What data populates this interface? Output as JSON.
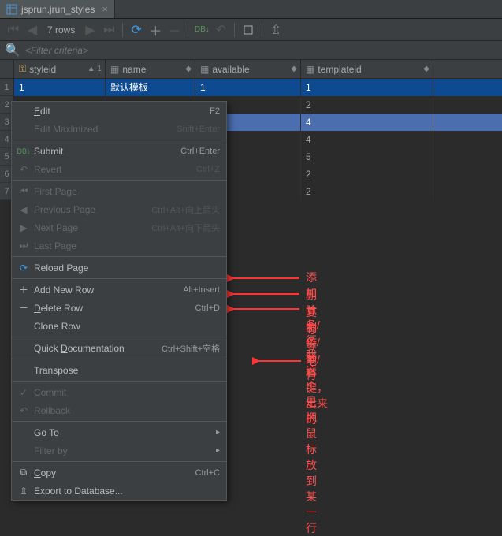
{
  "tab": {
    "title": "jsprun.jrun_styles"
  },
  "toolbar": {
    "rowcount": "7 rows"
  },
  "filter": {
    "placeholder": "<Filter criteria>"
  },
  "columns": [
    {
      "name": "styleid",
      "sort": "▲ 1"
    },
    {
      "name": "name",
      "sort": "◆"
    },
    {
      "name": "available",
      "sort": "◆"
    },
    {
      "name": "templateid",
      "sort": "◆"
    }
  ],
  "rows": [
    {
      "n": "1",
      "cells": [
        "1",
        "默认模板",
        "1",
        "1"
      ],
      "sel": true
    },
    {
      "n": "2",
      "cells": [
        "",
        "",
        "",
        "2"
      ]
    },
    {
      "n": "3",
      "cells": [
        "",
        "",
        "",
        "4"
      ],
      "hov": true
    },
    {
      "n": "4",
      "cells": [
        "",
        "",
        "",
        "4"
      ]
    },
    {
      "n": "5",
      "cells": [
        "",
        "",
        "",
        "5"
      ]
    },
    {
      "n": "6",
      "cells": [
        "",
        "",
        "",
        "2"
      ]
    },
    {
      "n": "7",
      "cells": [
        "",
        "",
        "",
        "2"
      ]
    }
  ],
  "menu": {
    "edit": "Edit",
    "edit_sc": "F2",
    "editmax": "Edit Maximized",
    "editmax_sc": "Shift+Enter",
    "submit": "Submit",
    "submit_sc": "Ctrl+Enter",
    "revert": "Revert",
    "revert_sc": "Ctrl+Z",
    "first": "First Page",
    "prev": "Previous Page",
    "prev_sc": "Ctrl+Alt+向上箭头",
    "next": "Next Page",
    "next_sc": "Ctrl+Alt+向下箭头",
    "last": "Last Page",
    "reload": "Reload Page",
    "addrow": "Add New Row",
    "addrow_sc": "Alt+Insert",
    "delrow": "Delete Row",
    "delrow_sc": "Ctrl+D",
    "clone": "Clone Row",
    "doc": "Quick Documentation",
    "doc_sc": "Ctrl+Shift+空格",
    "transpose": "Transpose",
    "commit": "Commit",
    "rollback": "Rollback",
    "goto": "Go To",
    "filterby": "Filter by",
    "copy": "Copy",
    "copy_sc": "Ctrl+C",
    "export": "Export to Database..."
  },
  "ann": {
    "a1": "添加一条/行",
    "a2": "删除一条/行",
    "a3": "复制一条/行",
    "a4": "等等吧",
    "a5": "我 这个是把鼠标放到某一行",
    "a6": "右键，出来的"
  }
}
